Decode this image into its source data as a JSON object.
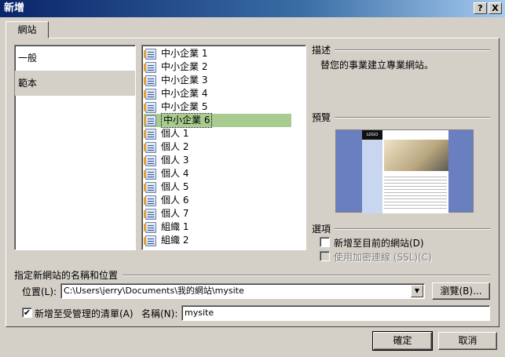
{
  "window": {
    "title": "新增",
    "help_label": "?",
    "close_label": "X"
  },
  "tab": {
    "label": "網站"
  },
  "categories": [
    {
      "label": "一般",
      "selected": false
    },
    {
      "label": "範本",
      "selected": true
    }
  ],
  "templates": [
    {
      "label": "中小企業 1",
      "selected": false
    },
    {
      "label": "中小企業 2",
      "selected": false
    },
    {
      "label": "中小企業 3",
      "selected": false
    },
    {
      "label": "中小企業 4",
      "selected": false
    },
    {
      "label": "中小企業 5",
      "selected": false
    },
    {
      "label": "中小企業 6",
      "selected": true
    },
    {
      "label": "個人 1",
      "selected": false
    },
    {
      "label": "個人 2",
      "selected": false
    },
    {
      "label": "個人 3",
      "selected": false
    },
    {
      "label": "個人 4",
      "selected": false
    },
    {
      "label": "個人 5",
      "selected": false
    },
    {
      "label": "個人 6",
      "selected": false
    },
    {
      "label": "個人 7",
      "selected": false
    },
    {
      "label": "組織 1",
      "selected": false
    },
    {
      "label": "組織 2",
      "selected": false
    }
  ],
  "scroll": {
    "up_glyph": "▲",
    "down_glyph": "▼"
  },
  "description": {
    "heading": "描述",
    "text": "替您的事業建立專業網站。"
  },
  "preview": {
    "heading": "預覽",
    "logo_text": "LOGO"
  },
  "options": {
    "heading": "選項",
    "add_to_current": {
      "label": "新增至目前的網站(D)",
      "checked": false,
      "enabled": true
    },
    "use_ssl": {
      "label": "使用加密連線 (SSL)(C)",
      "checked": false,
      "enabled": false
    }
  },
  "location": {
    "heading": "指定新網站的名稱和位置",
    "label": "位置(L):",
    "value": "C:\\Users\\jerry\\Documents\\我的網站\\mysite",
    "dropdown_glyph": "▼",
    "browse_label": "瀏覽(B)..."
  },
  "managed": {
    "label": "新增至受管理的清單(A)",
    "checked": true,
    "check_glyph": "✔"
  },
  "name": {
    "label": "名稱(N):",
    "value": "mysite"
  },
  "footer": {
    "ok_label": "確定",
    "cancel_label": "取消"
  }
}
